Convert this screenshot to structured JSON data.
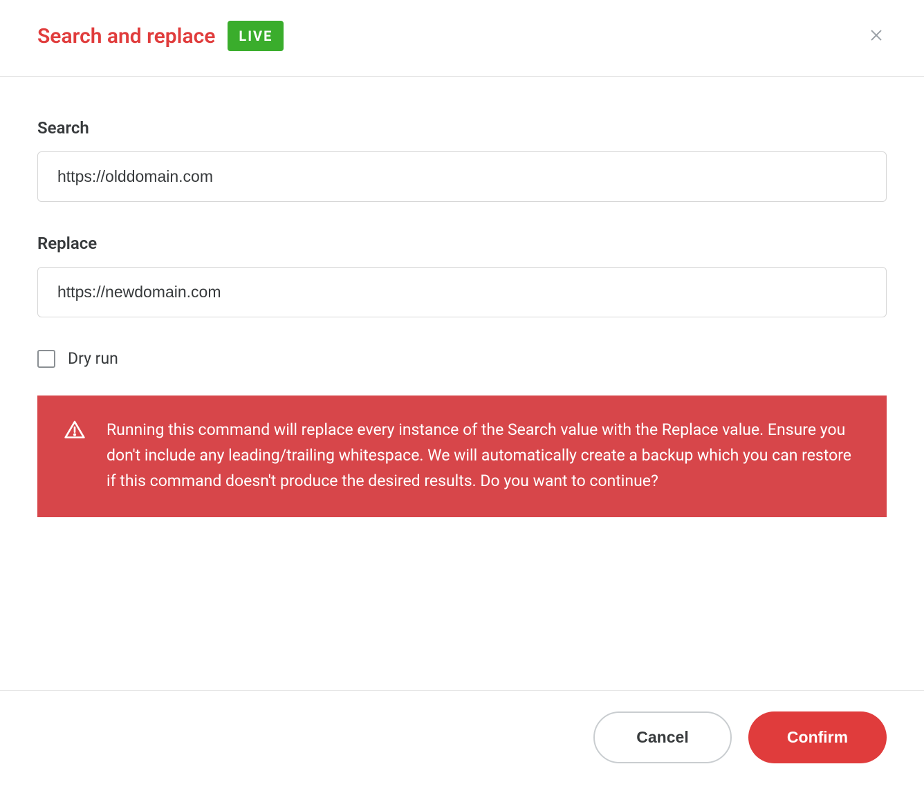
{
  "header": {
    "title": "Search and replace",
    "badge": "LIVE"
  },
  "form": {
    "search": {
      "label": "Search",
      "value": "https://olddomain.com"
    },
    "replace": {
      "label": "Replace",
      "value": "https://newdomain.com"
    },
    "dry_run": {
      "label": "Dry run",
      "checked": false
    }
  },
  "warning": {
    "text": "Running this command will replace every instance of the Search value with the Replace value. Ensure you don't include any leading/trailing whitespace. We will automatically create a backup which you can restore if this command doesn't produce the desired results. Do you want to continue?"
  },
  "footer": {
    "cancel": "Cancel",
    "confirm": "Confirm"
  }
}
